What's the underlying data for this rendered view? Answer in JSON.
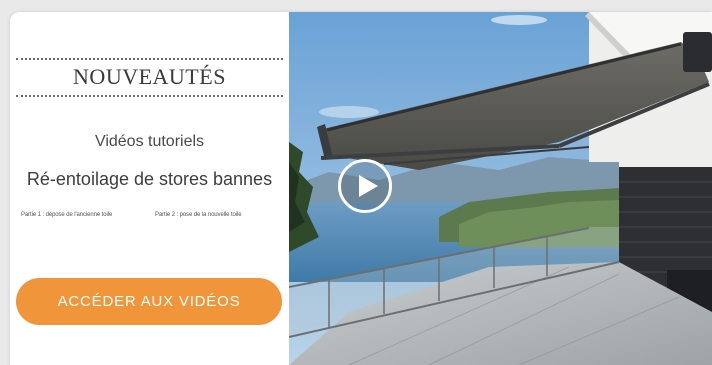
{
  "promo": {
    "heading": "NOUVEAUTÉS",
    "subtitle": "Vidéos tutoriels",
    "headline": "Ré-entoilage de stores bannes",
    "part1": "Partie 1 : dépose de l'ancienne toile",
    "part2": "Partie 2 : pose de la nouvelle toile",
    "cta_label": "ACCÉDER AUX VIDÉOS"
  },
  "video": {
    "play_icon": "play-icon"
  },
  "colors": {
    "accent": "#f0953a",
    "heading_text": "#3a3a3a",
    "sky": "#7fb1dd",
    "lake": "#4e86b2",
    "awning": "#5b5b55"
  }
}
